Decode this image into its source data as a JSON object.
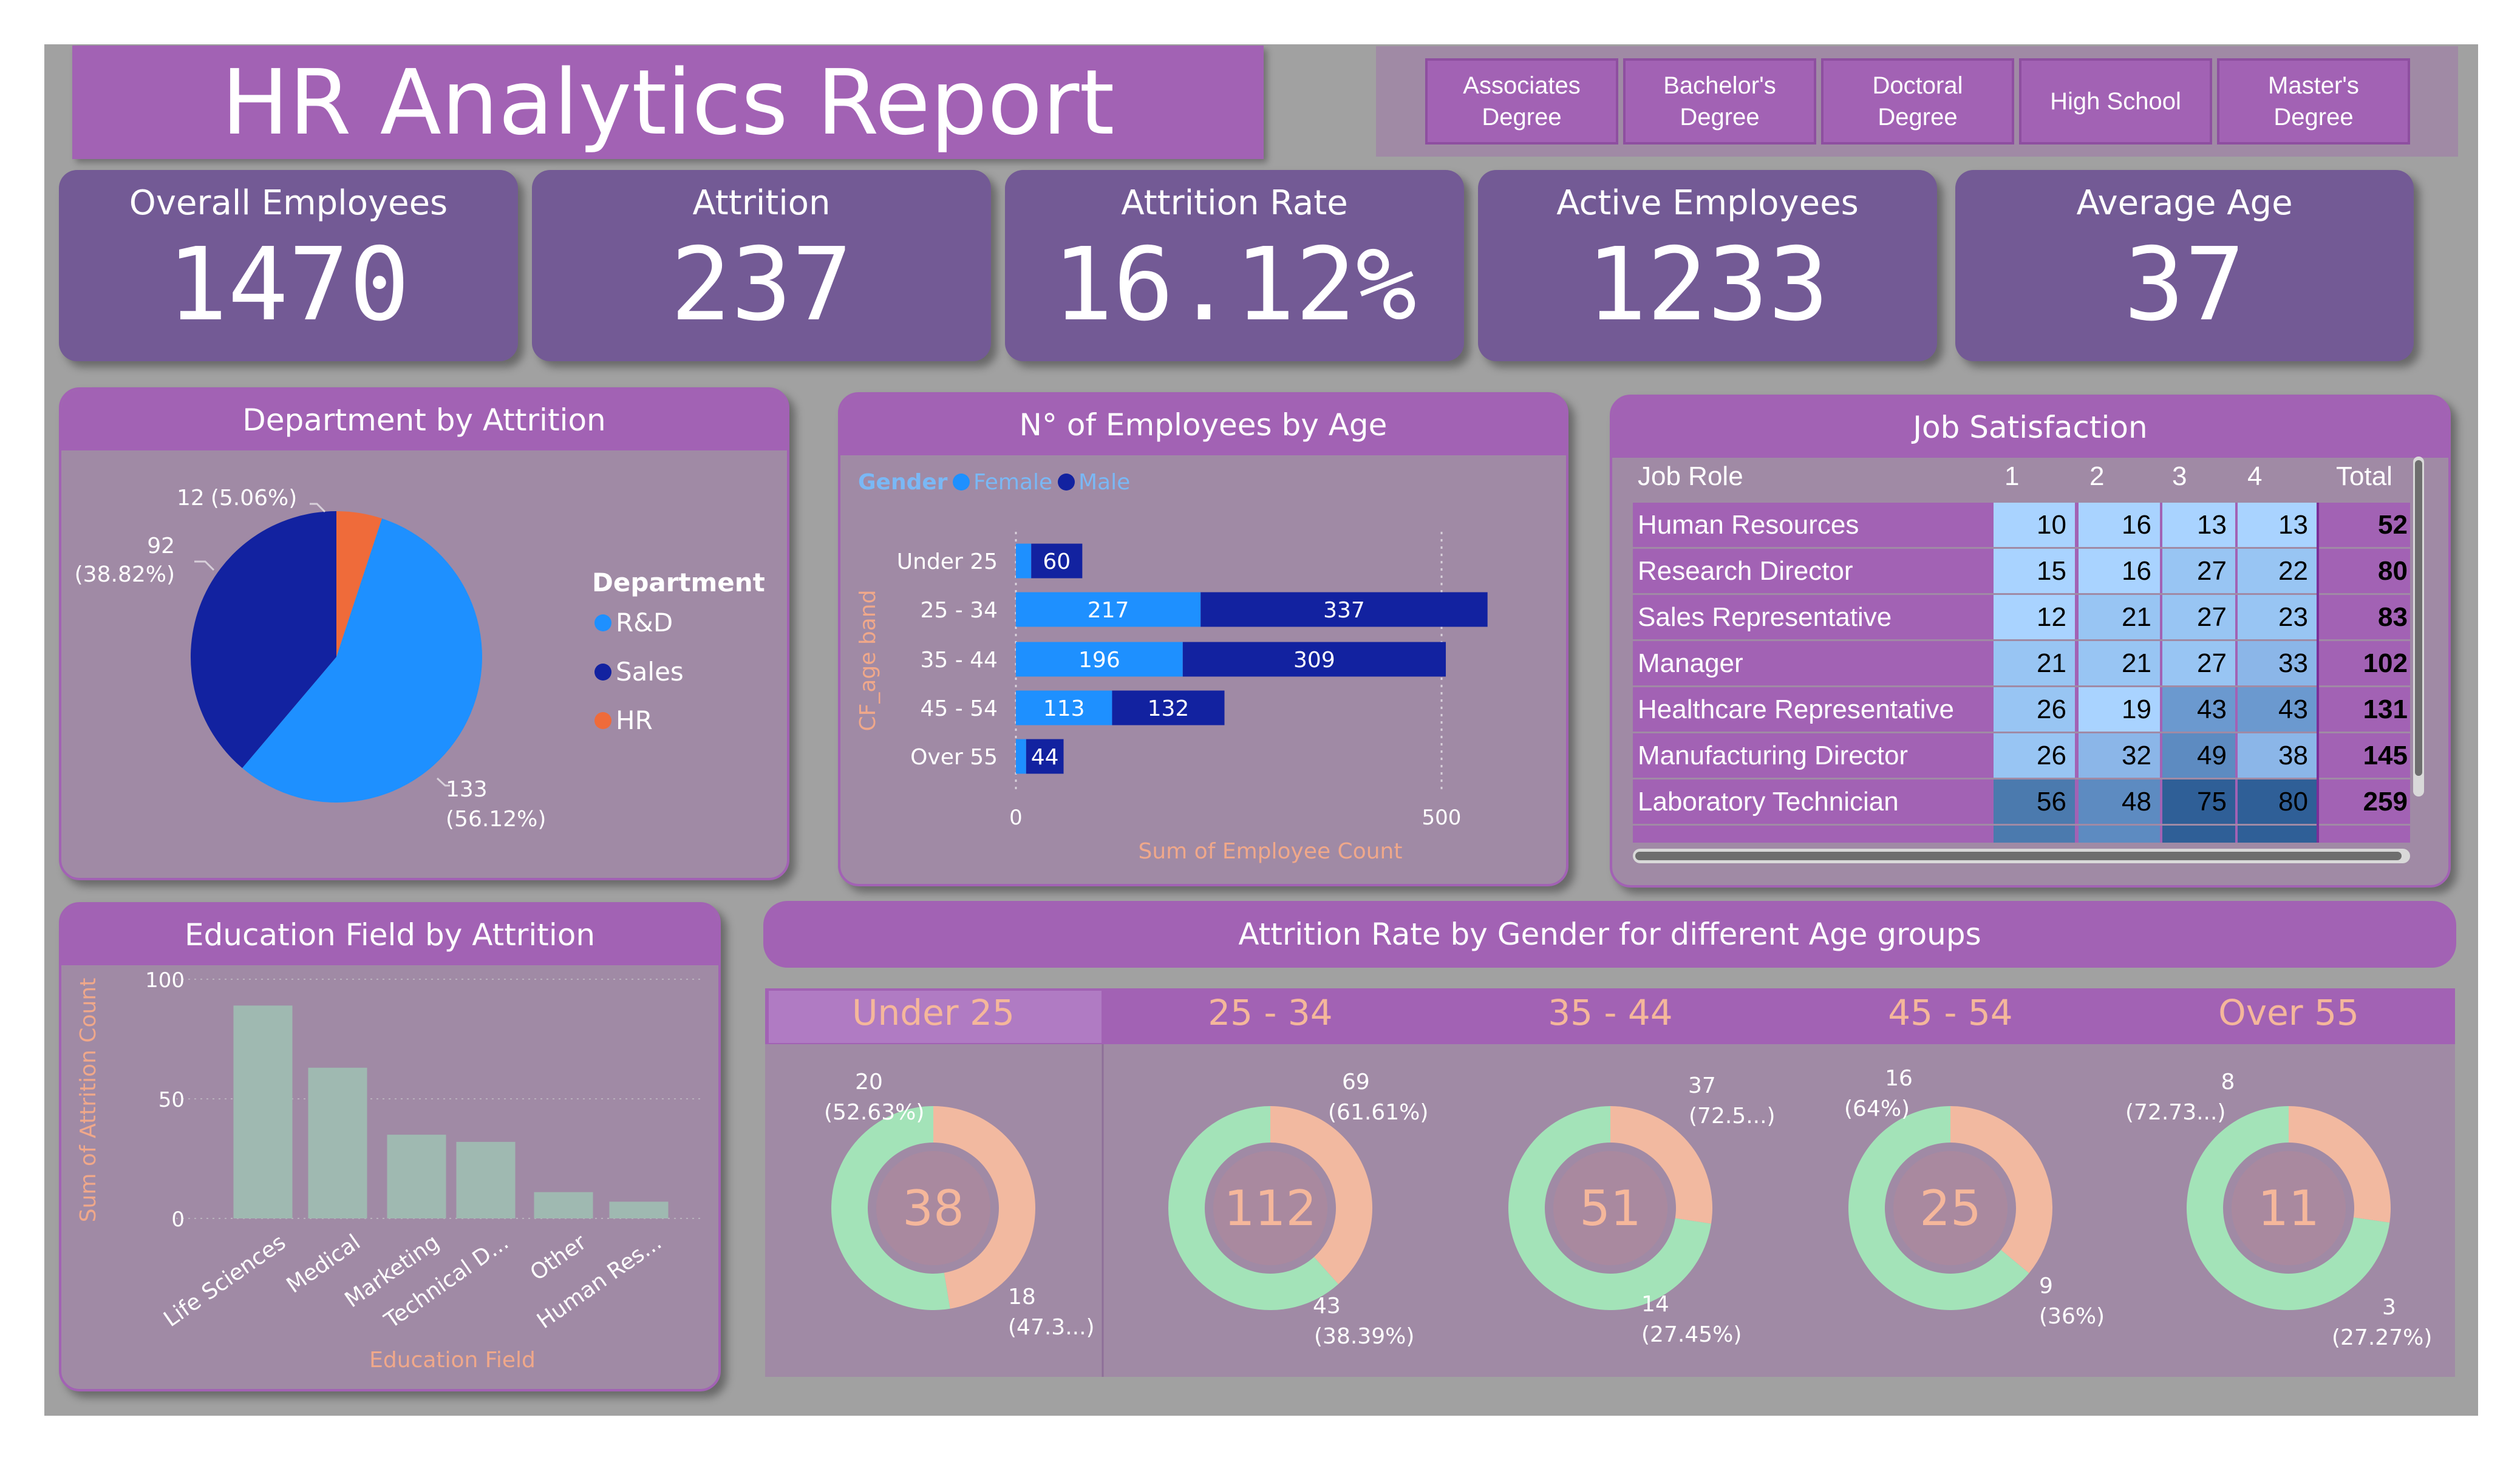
{
  "header": {
    "title": "HR Analytics Report"
  },
  "education_filter": {
    "options": [
      "Associates\nDegree",
      "Bachelor's\nDegree",
      "Doctoral\nDegree",
      "High School",
      "Master's\nDegree"
    ]
  },
  "kpis": [
    {
      "label": "Overall Employees",
      "value": "1470"
    },
    {
      "label": "Attrition",
      "value": "237"
    },
    {
      "label": "Attrition Rate",
      "value": "16.12%"
    },
    {
      "label": "Active Employees",
      "value": "1233"
    },
    {
      "label": "Average Age",
      "value": "37"
    }
  ],
  "colors": {
    "purple": "#a262b4",
    "kpi": "#735a95",
    "panel": "#a08aa5",
    "rd": "#1e90ff",
    "sales": "#1222a0",
    "hr": "#ef6b3a",
    "female_ring": "#f2b9a0",
    "male_ring": "#a3e3b8",
    "bar": "#9fb9b1"
  },
  "chart_data": [
    {
      "type": "pie",
      "title": "Department by Attrition",
      "legend_title": "Department",
      "legend_placement": "right",
      "slices": [
        {
          "label": "R&D",
          "value": 133,
          "pct_label": "(56.12%)",
          "color": "#1e90ff"
        },
        {
          "label": "Sales",
          "value": 92,
          "pct_label": "(38.82%)",
          "color": "#1222a0"
        },
        {
          "label": "HR",
          "value": 12,
          "pct_label": "(5.06%)",
          "color": "#ef6b3a"
        }
      ]
    },
    {
      "type": "bar",
      "orientation": "horizontal",
      "stacked": true,
      "title": "N° of Employees by Age",
      "legend_title": "Gender",
      "xlabel": "Sum of Employee Count",
      "ylabel": "CF_age band",
      "categories": [
        "Under 25",
        "25 - 34",
        "35 - 44",
        "45 - 54",
        "Over 55"
      ],
      "series": [
        {
          "name": "Female",
          "color": "#1e90ff",
          "values": [
            null,
            217,
            196,
            113,
            null
          ]
        },
        {
          "name": "Male",
          "color": "#1222a0",
          "values": [
            60,
            337,
            309,
            132,
            44
          ]
        }
      ],
      "xticks": [
        "0",
        "500"
      ],
      "xlim": [
        0,
        500
      ]
    },
    {
      "type": "table",
      "title": "Job Satisfaction",
      "columns": [
        "Job Role",
        "1",
        "2",
        "3",
        "4",
        "Total"
      ],
      "rows": [
        [
          "Human Resources",
          "10",
          "16",
          "13",
          "13",
          "52"
        ],
        [
          "Research Director",
          "15",
          "16",
          "27",
          "22",
          "80"
        ],
        [
          "Sales Representative",
          "12",
          "21",
          "27",
          "23",
          "83"
        ],
        [
          "Manager",
          "21",
          "21",
          "27",
          "33",
          "102"
        ],
        [
          "Healthcare Representative",
          "26",
          "19",
          "43",
          "43",
          "131"
        ],
        [
          "Manufacturing Director",
          "26",
          "32",
          "49",
          "38",
          "145"
        ],
        [
          "Laboratory Technician",
          "56",
          "48",
          "75",
          "80",
          "259"
        ]
      ]
    },
    {
      "type": "bar",
      "title": "Education Field by Attrition",
      "xlabel": "Education Field",
      "ylabel": "Sum of Attrition Count",
      "categories": [
        "Life Sciences",
        "Medical",
        "Marketing",
        "Technical D...",
        "Other",
        "Human Res..."
      ],
      "values": [
        89,
        63,
        35,
        32,
        11,
        7
      ],
      "yticks": [
        "0",
        "50",
        "100"
      ],
      "ylim": [
        0,
        100
      ]
    },
    {
      "type": "donut",
      "title": "Attrition Rate by Gender for different Age groups",
      "groups": [
        {
          "label": "Under 25",
          "total": "38",
          "male": 20,
          "male_pct": "(52.63%)",
          "female": 18,
          "female_pct": "(47.3...)"
        },
        {
          "label": "25 - 34",
          "total": "112",
          "male": 69,
          "male_pct": "(61.61%)",
          "female": 43,
          "female_pct": "(38.39%)"
        },
        {
          "label": "35 - 44",
          "total": "51",
          "male": 37,
          "male_pct": "(72.5...)",
          "female": 14,
          "female_pct": "(27.45%)"
        },
        {
          "label": "45 - 54",
          "total": "25",
          "male": 16,
          "male_pct": "(64%)",
          "female": 9,
          "female_pct": "(36%)"
        },
        {
          "label": "Over 55",
          "total": "11",
          "male": 8,
          "male_pct": "(72.73...)",
          "female": 3,
          "female_pct": "(27.27%)"
        }
      ]
    }
  ]
}
